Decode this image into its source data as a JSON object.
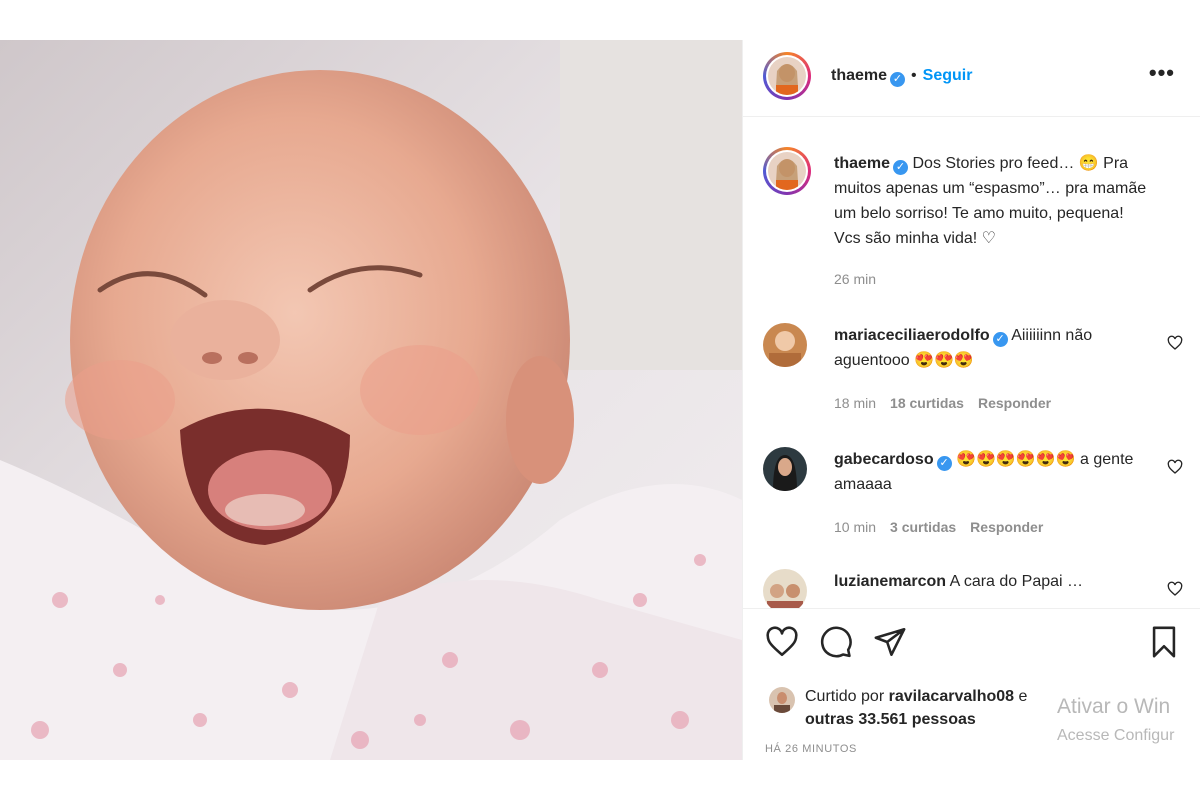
{
  "post": {
    "author": "thaeme",
    "follow_label": "Seguir",
    "separator": "•",
    "more_label": "•••"
  },
  "caption": {
    "username": "thaeme",
    "text": "Dos Stories pro feed… 😁 Pra muitos apenas um “espasmo”… pra mamãe um belo sorriso! Te amo muito, pequena! Vcs são minha vida! ♡",
    "time": "26 min"
  },
  "comments": [
    {
      "username": "mariaceciliaerodolfo",
      "text": "Aiiiiiinn não aguentooo 😍😍😍",
      "time": "18 min",
      "likes": "18 curtidas",
      "reply": "Responder"
    },
    {
      "username": "gabecardoso",
      "text": "😍😍😍😍😍😍 a gente amaaaa",
      "time": "10 min",
      "likes": "3 curtidas",
      "reply": "Responder"
    },
    {
      "username": "luzianemarcon",
      "text": "A cara do Papai …"
    }
  ],
  "likes": {
    "prefix": "Curtido por",
    "user": "ravilacarvalho08",
    "conj": "e",
    "rest": "outras 33.561 pessoas"
  },
  "timestamp": "HÁ 26 MINUTOS",
  "watermark": {
    "line1": "Ativar o Win",
    "line2": "Acesse Configur"
  },
  "colors": {
    "link_blue": "#0095f6",
    "verified_blue": "#3897f0",
    "muted": "#8e8e8e"
  }
}
